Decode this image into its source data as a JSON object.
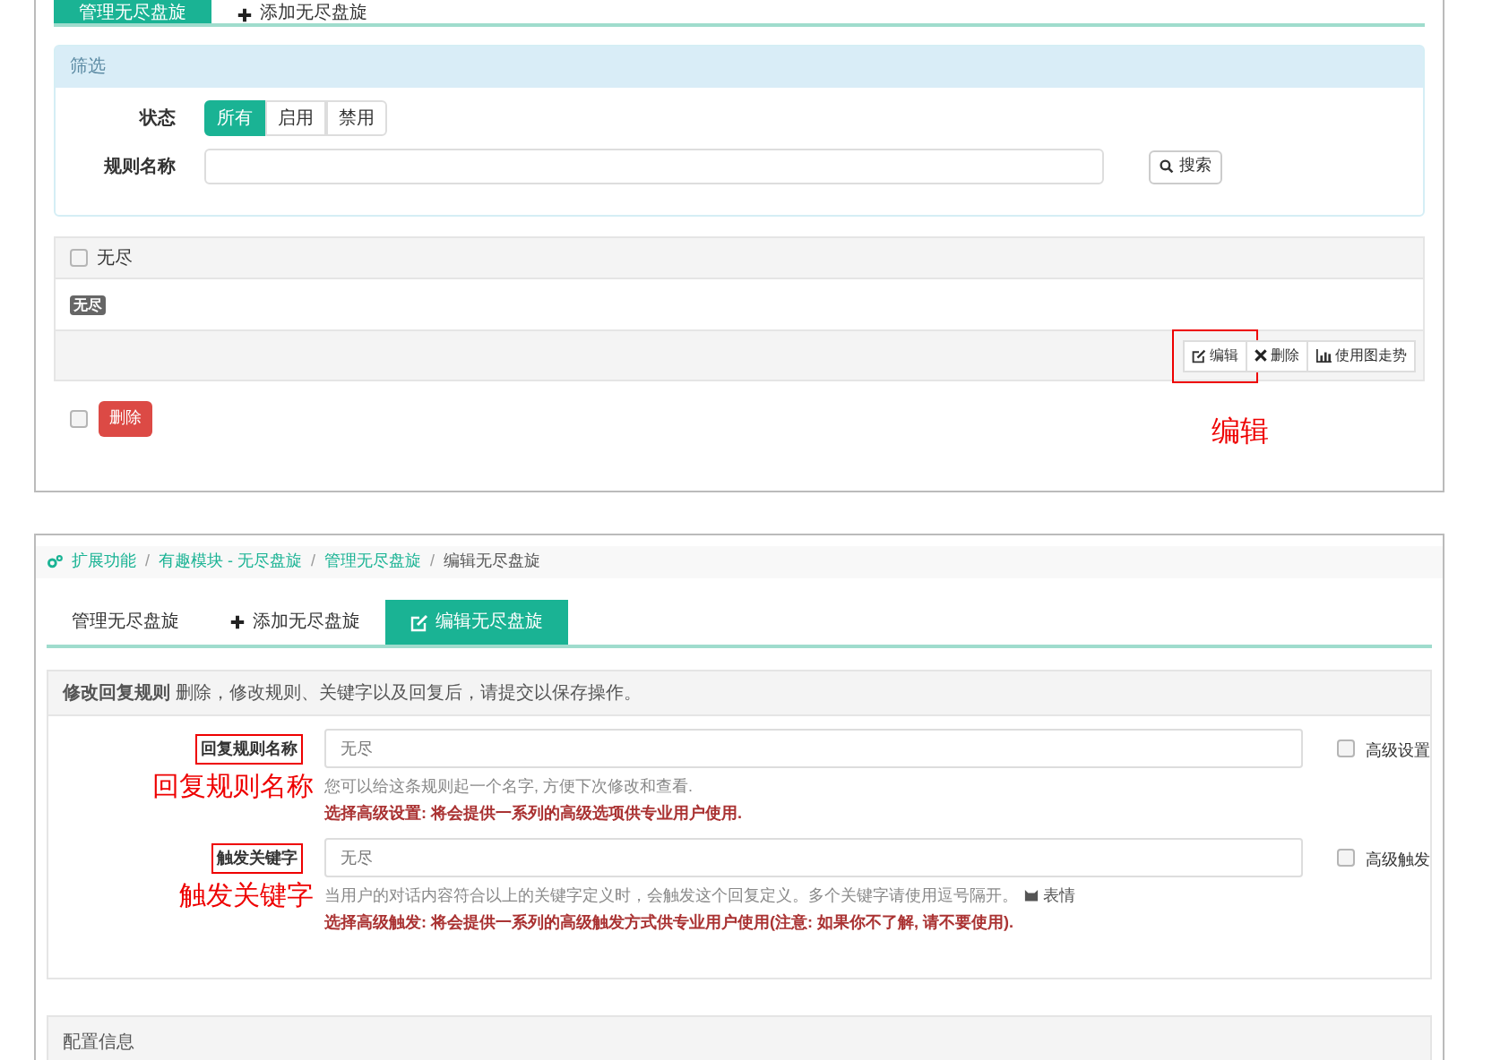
{
  "top_panel": {
    "tabs": [
      {
        "label": "管理无尽盘旋",
        "selected": true
      },
      {
        "label": "添加无尽盘旋",
        "selected": false,
        "kind": "add"
      }
    ],
    "filter": {
      "title": "筛选",
      "status_label": "状态",
      "status_options": [
        {
          "label": "所有",
          "selected": true
        },
        {
          "label": "启用",
          "selected": false
        },
        {
          "label": "禁用",
          "selected": false
        }
      ],
      "name_label": "规则名称",
      "search_button": "搜索"
    },
    "rule": {
      "name": "无尽",
      "checked": false,
      "badge": "无尽",
      "actions": [
        {
          "kind": "edit",
          "label": "编辑",
          "annotated": true
        },
        {
          "kind": "delete",
          "label": "删除",
          "annotated": false
        },
        {
          "kind": "chart",
          "label": "使用图走势",
          "annotated": false
        }
      ]
    },
    "bulk": {
      "checked": false,
      "delete_button": "删除"
    },
    "annotation": "编辑"
  },
  "bottom_panel": {
    "breadcrumb": [
      {
        "label": "扩展功能"
      },
      {
        "separator": "/",
        "label": "有趣模块 - 无尽盘旋"
      },
      {
        "separator": "/",
        "label": "管理无尽盘旋"
      },
      {
        "separator": "/",
        "label": "编辑无尽盘旋"
      }
    ],
    "tabs": [
      {
        "label": "管理无尽盘旋",
        "selected": false
      },
      {
        "label": "添加无尽盘旋",
        "selected": false,
        "kind": "add"
      },
      {
        "label": "编辑无尽盘旋",
        "selected": true,
        "kind": "edit"
      }
    ],
    "section_title": "**修改回复规则** 删除，修改规则、关键字以及回复后，请提交以保存操作。",
    "fields": [
      {
        "label": "回复规则名称",
        "annotated": true,
        "annotation": "回复规则名称",
        "value": "无尽",
        "option_label": "高级设置",
        "option_checked": false,
        "help": "您可以给这条规则起一个名字, 方便下次修改和查看.",
        "warning": "选择高级设置: 将会提供一系列的高级选项供专业用户使用."
      },
      {
        "label": "触发关键字",
        "annotated": true,
        "annotation": "触发关键字",
        "value": "无尽",
        "option_label": "高级触发",
        "option_checked": false,
        "help": "当用户的对话内容符合以上的关键字定义时，会触发这个回复定义。多个关键字请使用逗号隔开。",
        "emoji_link": "表情",
        "warning": "选择高级触发: 将会提供一系列的高级触发方式供专业用户使用(注意: 如果你不了解, 请不要使用)."
      }
    ],
    "config_title": "配置信息"
  }
}
